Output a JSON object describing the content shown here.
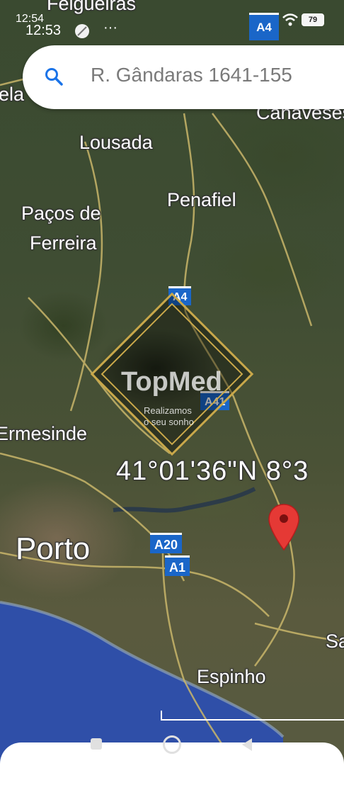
{
  "status": {
    "time_primary": "12:54",
    "time_secondary": "12:53",
    "dots": "···",
    "battery": "79",
    "road_badge": "A4"
  },
  "search": {
    "query": "R. Gândaras 1641-155"
  },
  "map": {
    "places": {
      "felgueiras": "Felgueiras",
      "ela": "ela",
      "canaveses": "Canaveses",
      "lousada": "Lousada",
      "penafiel": "Penafiel",
      "pacos_1": "Paços de",
      "pacos_2": "Ferreira",
      "ermesinde": "Ermesinde",
      "porto": "Porto",
      "espinho": "Espinho",
      "sa": "Sa"
    },
    "roads": {
      "a4": "A4",
      "a41": "A41",
      "a20": "A20",
      "a1": "A1"
    },
    "coordinates": "41°01'36\"N 8°3"
  },
  "watermark": {
    "brand": "TopMed",
    "tagline_1": "Realizamos",
    "tagline_2": "o seu sonho"
  },
  "colors": {
    "pin": "#e53935",
    "shield": "#1a66c8",
    "search_icon": "#1a73e8",
    "ocean": "#2f4fa8",
    "watermark_gold": "#c9a84a"
  }
}
